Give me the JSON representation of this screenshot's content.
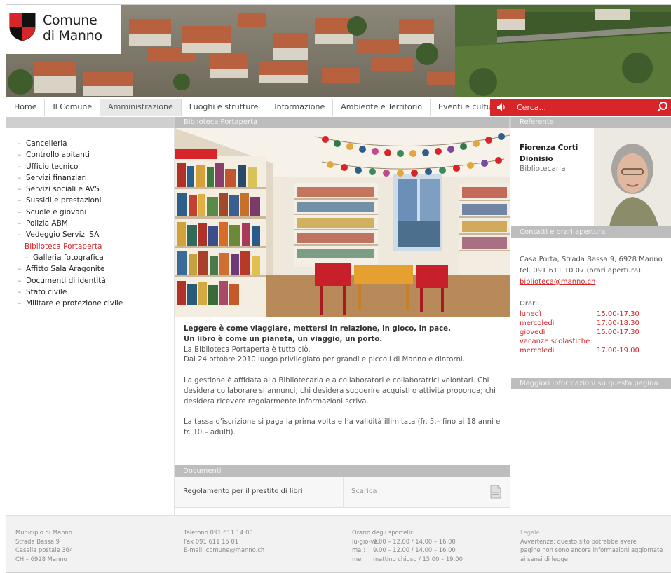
{
  "logo": {
    "line1": "Comune",
    "line2": "di Manno"
  },
  "nav": {
    "tabs": [
      {
        "label": "Home"
      },
      {
        "label": "Il Comune"
      },
      {
        "label": "Amministrazione"
      },
      {
        "label": "Luoghi e strutture"
      },
      {
        "label": "Informazione"
      },
      {
        "label": "Ambiente e Territorio"
      },
      {
        "label": "Eventi e cultura"
      }
    ],
    "active_tab": "Amministrazione",
    "search_placeholder": "Cerca..."
  },
  "band": {
    "center_title": "Biblioteca Portaperta",
    "right_title": "Referente"
  },
  "sidebar": {
    "items": [
      {
        "label": "Cancelleria"
      },
      {
        "label": "Controllo abitanti"
      },
      {
        "label": "Ufficio tecnico"
      },
      {
        "label": "Servizi finanziari"
      },
      {
        "label": "Servizi sociali e AVS"
      },
      {
        "label": "Sussidi e prestazioni"
      },
      {
        "label": "Scuole e giovani"
      },
      {
        "label": "Polizia ABM"
      },
      {
        "label": "Vedeggio Servizi SA"
      },
      {
        "label": "Biblioteca Portaperta"
      },
      {
        "label": "Galleria fotografica"
      },
      {
        "label": "Affitto Sala Aragonite"
      },
      {
        "label": "Documenti di identità"
      },
      {
        "label": "Stato civile"
      },
      {
        "label": "Militare e protezione civile"
      }
    ],
    "active_item": "Biblioteca Portaperta"
  },
  "article": {
    "lead1": "Leggere è come viaggiare, mettersi in relazione, in gioco, in pace.",
    "lead2": "Un libro è come un pianeta, un viaggio, un porto.",
    "p1a": "La Biblioteca Portaperta è tutto ciò.",
    "p1b": "Dal 24 ottobre 2010 luogo privilegiato per grandi e piccoli di Manno e dintorni.",
    "p2": "La gestione è affidata alla Bibliotecaria e a collaboratori e collaboratrici volontari. Chi desidera collaborare si annunci; chi desidera suggerire acquisti o attività proponga; chi desidera ricevere regolarmente informazioni scriva.",
    "p3": "La tassa d'iscrizione si paga la prima volta e ha validità illimitata (fr. 5.– fino ai 18 anni e fr. 10.– adulti)."
  },
  "documents": {
    "title": "Documenti",
    "items": [
      {
        "name": "Regolamento per il prestito di libri",
        "action": "Scarica"
      }
    ]
  },
  "contact": {
    "name_line1": "Fiorenza Corti",
    "name_line2": "Dionisio",
    "role": "Bibliotecaria",
    "section_title": "Contatti e orari apertura",
    "address": "Casa Porta, Strada Bassa 9, 6928 Manno",
    "phone": "tel. 091 611 10 07 (orari apertura)",
    "email": "biblioteca@manno.ch",
    "hours_label": "Orari:",
    "hours": [
      {
        "day": "lunedì",
        "time": "15.00-17.30"
      },
      {
        "day": "mercoledì",
        "time": "17.00-18.30"
      },
      {
        "day": "giovedì",
        "time": "15.00-17.30"
      }
    ],
    "holiday_label": "vacanze scolastiche:",
    "holiday_hours": [
      {
        "day": "mercoledì",
        "time": "17.00-19.00"
      }
    ],
    "bar3_title": "Maggiori informazioni su questa pagina"
  },
  "footer": {
    "col1": [
      "Municipio di Manno",
      "Strada Bassa 9",
      "Casella postale 364",
      "CH – 6928 Manno"
    ],
    "col2": [
      "Telefono 091 611 14 00",
      "Fax 091 611 15 01",
      "E-mail: comune@manno.ch"
    ],
    "col3_title": "Orario degli sportelli:",
    "col3_rows": [
      {
        "k": "lu-gio-ve:",
        "v": "9.00 – 12.00 / 14.00 – 16.00"
      },
      {
        "k": "ma.:",
        "v": "9.00 – 12.00 / 14.00 – 16.00"
      },
      {
        "k": "me:",
        "v": "mattino chiuso / 15.00 – 19.00"
      }
    ],
    "col4_title": "Legale",
    "col4": [
      "Avvertenze: questo sito potrebbe avere",
      "pagine non sono ancora informazioni aggiornate",
      "ai sensi di legge"
    ]
  },
  "colors": {
    "brand_red": "#d7262a",
    "bar_gray": "#bdbdbd"
  }
}
